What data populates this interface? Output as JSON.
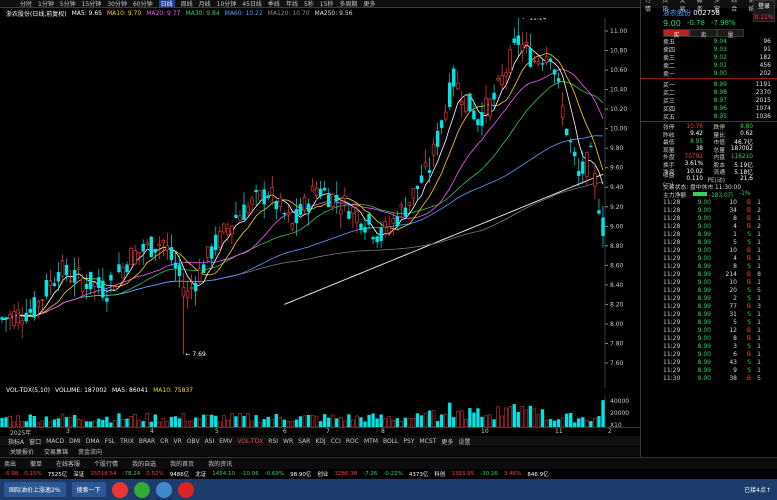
{
  "colors": {
    "up": "#ff3c3c",
    "down": "#2fd35a",
    "ma5": "#ffffff",
    "ma10": "#ffd700",
    "ma20": "#ff55ff",
    "ma30": "#34c759",
    "ma60": "#5aa0ff",
    "ma120": "#7a7a7a",
    "ma250": "#e0e0e0"
  },
  "top_periods": [
    "分时",
    "1分钟",
    "5分钟",
    "15分钟",
    "30分钟",
    "60分钟",
    "日线",
    "周线",
    "月线",
    "10分钟",
    "45日线",
    "季线",
    "年线",
    "5秒",
    "15秒",
    "多周期",
    "更多"
  ],
  "active_period": "日线",
  "ma_header": {
    "name": "浙农股份(日线,前复权)",
    "ma5": "MA5: 9.65",
    "ma10": "MA10: 9.70",
    "ma20": "MA20: 9.77",
    "ma30": "MA30: 9.84",
    "ma60": "MA60: 10.22",
    "ma120": "MA120: 10.70",
    "ma250": "MA250: 9.56"
  },
  "price_axis": [
    "11.00",
    "10.80",
    "10.60",
    "10.40",
    "10.20",
    "10.00",
    "9.80",
    "9.60",
    "9.40",
    "9.20",
    "9.00",
    "8.80",
    "8.60",
    "8.40",
    "8.20",
    "8.00",
    "7.80",
    "7.60"
  ],
  "annotations": {
    "high": "11.14",
    "low": "7.69"
  },
  "vol_header": {
    "name": "VOL-TDX(5,10)",
    "volume": "VOLUME: 187002",
    "ma5": "MA5: 86041",
    "ma10": "MA10: 75837"
  },
  "vol_axis": [
    "40000",
    "20000",
    "X10"
  ],
  "date_axis": [
    {
      "label": "2025年",
      "pos": 10
    },
    {
      "label": "3",
      "pos": 66
    },
    {
      "label": "4",
      "pos": 150
    },
    {
      "label": "5",
      "pos": 215
    },
    {
      "label": "6",
      "pos": 283
    },
    {
      "label": "7",
      "pos": 326
    },
    {
      "label": "8",
      "pos": 381
    },
    {
      "label": "10",
      "pos": 481
    },
    {
      "label": "11",
      "pos": 555
    },
    {
      "label": "2",
      "pos": 608
    }
  ],
  "indicator_tabs": [
    "指标A",
    "窗口",
    "MACD",
    "DMI",
    "DMA",
    "FSL",
    "TRIX",
    "BRAR",
    "CR",
    "VR",
    "OBV",
    "ASI",
    "EMV",
    "VOL-TDX",
    "RSI",
    "WR",
    "SAR",
    "KDJ",
    "CCI",
    "ROC",
    "MTM",
    "BOLL",
    "PSY",
    "MCST",
    "更多",
    "设置"
  ],
  "active_indicator": "VOL-TDX",
  "sub_tabs": [
    "关联报价",
    "交易集锦",
    "资金流向"
  ],
  "footer_tabs": [
    "卖出",
    "撤单",
    "在线客服",
    "个股行情",
    "我的自选",
    "我的首页",
    "我的资讯"
  ],
  "index_bar": [
    {
      "text": "-5.98",
      "color": "red"
    },
    {
      "text": "0.15%",
      "color": "red"
    },
    {
      "text": "7525亿",
      "color": "white"
    },
    {
      "text": "深证",
      "color": "white"
    },
    {
      "text": "15018.54",
      "color": "red"
    },
    {
      "text": "-78.24",
      "color": "green"
    },
    {
      "text": "0.52%",
      "color": "red"
    },
    {
      "text": "9486亿",
      "color": "white"
    },
    {
      "text": "北证",
      "color": "white"
    },
    {
      "text": "1454.10",
      "color": "green"
    },
    {
      "text": "-10.06",
      "color": "green"
    },
    {
      "text": "-0.69%",
      "color": "green"
    },
    {
      "text": "98.90亿",
      "color": "white"
    },
    {
      "text": "创业",
      "color": "white"
    },
    {
      "text": "3286.38",
      "color": "red"
    },
    {
      "text": "-7.26",
      "color": "green"
    },
    {
      "text": "-0.22%",
      "color": "green"
    },
    {
      "text": "4373亿",
      "color": "white"
    },
    {
      "text": "科创",
      "color": "white"
    },
    {
      "text": "1393.95",
      "color": "red"
    },
    {
      "text": "-30.26",
      "color": "green"
    },
    {
      "text": "3.46%",
      "color": "red"
    },
    {
      "text": "846.9亿",
      "color": "white"
    }
  ],
  "right_panel": {
    "menu": [
      "行情",
      "资讯",
      "交易",
      "服务",
      "多窗",
      "综合",
      "系统",
      "帮助"
    ],
    "stock_name": "浙农股份",
    "stock_code": "002758",
    "login_label": "登录",
    "login_pct": "0.11%",
    "price": "9.00",
    "change": "-0.78",
    "change_pct": "-7.98%",
    "tabs": [
      "买",
      "卖",
      "量"
    ],
    "asks": [
      {
        "label": "卖五",
        "price": "9.04",
        "vol": "96"
      },
      {
        "label": "卖四",
        "price": "9.03",
        "vol": "91"
      },
      {
        "label": "卖三",
        "price": "9.02",
        "vol": "182"
      },
      {
        "label": "卖二",
        "price": "9.01",
        "vol": "456"
      },
      {
        "label": "卖一",
        "price": "9.00",
        "vol": "202"
      }
    ],
    "bids": [
      {
        "label": "买一",
        "price": "8.99",
        "vol": "1191"
      },
      {
        "label": "买二",
        "price": "8.98",
        "vol": "2370"
      },
      {
        "label": "买三",
        "price": "8.97",
        "vol": "2015"
      },
      {
        "label": "买四",
        "price": "8.96",
        "vol": "1074"
      },
      {
        "label": "买五",
        "price": "8.95",
        "vol": "1036"
      }
    ],
    "stats": [
      {
        "k1": "张停",
        "v1": "10.76",
        "k2": "跌停",
        "v2": "8.80"
      },
      {
        "k1": "昨收",
        "v1": "9.42",
        "k2": "量比",
        "v2": "0.62"
      },
      {
        "k1": "最低",
        "v1": "8.95",
        "k2": "市值",
        "v2": "46.7亿"
      },
      {
        "k1": "现量",
        "v1": "38",
        "k2": "总量",
        "v2": "187002"
      },
      {
        "k1": "外盘",
        "v1": "70792",
        "k2": "内盘",
        "v2": "116210"
      },
      {
        "k1": "换手",
        "v1": "3.61%",
        "k2": "股本",
        "v2": "5.19亿"
      },
      {
        "k1": "净资",
        "v1": "10.02",
        "k2": "流通",
        "v2": "5.18亿"
      },
      {
        "k1": "收益(一)",
        "v1": "0.110",
        "k2": "PE(动)",
        "v2": "21.6"
      }
    ],
    "trade_status": "交易状态: 盘中休市 11:30:00",
    "main_flow_label": "主力净额",
    "main_flow_value": "-183.0万",
    "main_flow_pct": "-1%",
    "ticks": [
      {
        "t": "11:28",
        "p": "9.00",
        "v": "10",
        "s": "B",
        "n": "1"
      },
      {
        "t": "11:28",
        "p": "9.00",
        "v": "34",
        "s": "B",
        "n": "2"
      },
      {
        "t": "11:28",
        "p": "9.00",
        "v": "8",
        "s": "B",
        "n": "1"
      },
      {
        "t": "11:28",
        "p": "9.00",
        "v": "4",
        "s": "B",
        "n": "2"
      },
      {
        "t": "11:28",
        "p": "8.99",
        "v": "1",
        "s": "S",
        "n": "1"
      },
      {
        "t": "11:28",
        "p": "8.99",
        "v": "5",
        "s": "S",
        "n": "1"
      },
      {
        "t": "11:29",
        "p": "9.00",
        "v": "10",
        "s": "B",
        "n": "1"
      },
      {
        "t": "11:29",
        "p": "9.00",
        "v": "4",
        "s": "B",
        "n": "1"
      },
      {
        "t": "11:29",
        "p": "8.99",
        "v": "8",
        "s": "S",
        "n": "1"
      },
      {
        "t": "11:29",
        "p": "8.99",
        "v": "214",
        "s": "B",
        "n": "8"
      },
      {
        "t": "11:29",
        "p": "9.00",
        "v": "10",
        "s": "B",
        "n": "1"
      },
      {
        "t": "11:29",
        "p": "8.99",
        "v": "20",
        "s": "S",
        "n": "5"
      },
      {
        "t": "11:29",
        "p": "8.99",
        "v": "2",
        "s": "S",
        "n": "1"
      },
      {
        "t": "11:29",
        "p": "8.99",
        "v": "77",
        "s": "B",
        "n": "3"
      },
      {
        "t": "11:29",
        "p": "8.99",
        "v": "31",
        "s": "S",
        "n": "1"
      },
      {
        "t": "11:29",
        "p": "8.99",
        "v": "5",
        "s": "S",
        "n": "1"
      },
      {
        "t": "11:29",
        "p": "9.00",
        "v": "12",
        "s": "B",
        "n": "1"
      },
      {
        "t": "11:29",
        "p": "9.00",
        "v": "8",
        "s": "B",
        "n": "1"
      },
      {
        "t": "11:29",
        "p": "8.99",
        "v": "3",
        "s": "S",
        "n": "1"
      },
      {
        "t": "11:29",
        "p": "9.00",
        "v": "6",
        "s": "B",
        "n": "1"
      },
      {
        "t": "11:29",
        "p": "8.99",
        "v": "43",
        "s": "S",
        "n": "1"
      },
      {
        "t": "11:29",
        "p": "8.99",
        "v": "9",
        "s": "S",
        "n": "1"
      },
      {
        "t": "11:30",
        "p": "9.00",
        "v": "38",
        "s": "B",
        "n": "5"
      }
    ]
  },
  "taskbar": {
    "item1": "国际油价上涨逾2%",
    "item2": "搜索一下",
    "clock": "已接4点↑"
  }
}
